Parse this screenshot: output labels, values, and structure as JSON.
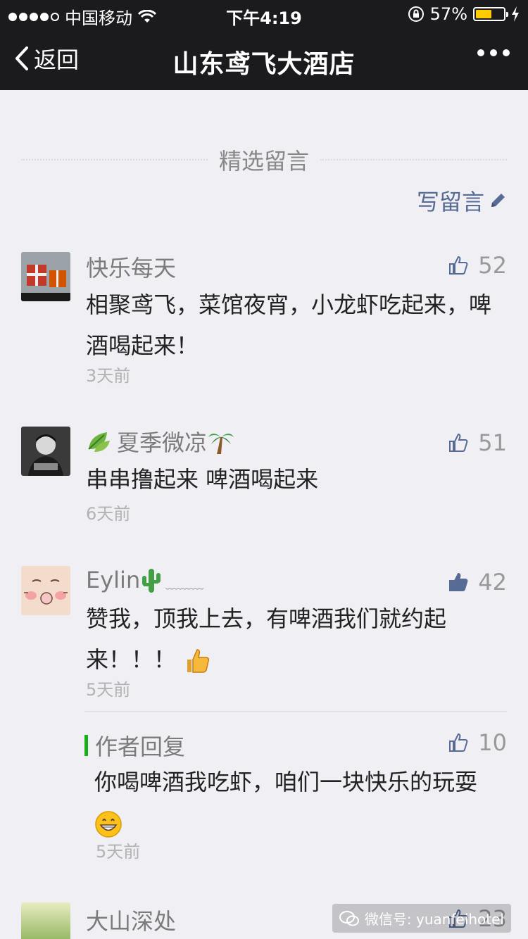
{
  "status_bar": {
    "carrier": "中国移动",
    "time": "下午4:19",
    "battery": "57%",
    "battery_level": 0.57
  },
  "nav": {
    "back_label": "返回",
    "title": "山东鸢飞大酒店"
  },
  "section": {
    "header": "精选留言",
    "write_label": "写留言"
  },
  "comments": [
    {
      "name": "快乐每天",
      "likes": "52",
      "text": "相聚鸢飞，菜馆夜宵，小龙虾吃起来，啤酒喝起来！",
      "time": "3天前"
    },
    {
      "name": "夏季微凉",
      "likes": "51",
      "text": "串串撸起来  啤酒喝起来",
      "time": "6天前"
    },
    {
      "name": "Eylin",
      "name_suffix": "﹏﹏﹏",
      "likes": "42",
      "text": "赞我，顶我上去，有啤酒我们就约起来！！！",
      "time": "5天前",
      "reply": {
        "label": "作者回复",
        "likes": "10",
        "text": "你喝啤酒我吃虾，咱们一块快乐的玩耍",
        "time": "5天前"
      }
    },
    {
      "name": "大山深处",
      "likes": "23"
    }
  ],
  "watermark": "微信号: yuanfeihotel",
  "colors": {
    "nav_bg": "#1b1b1d",
    "link": "#576b95",
    "reply_bar": "#1aad19",
    "battery": "#ffcc00"
  }
}
